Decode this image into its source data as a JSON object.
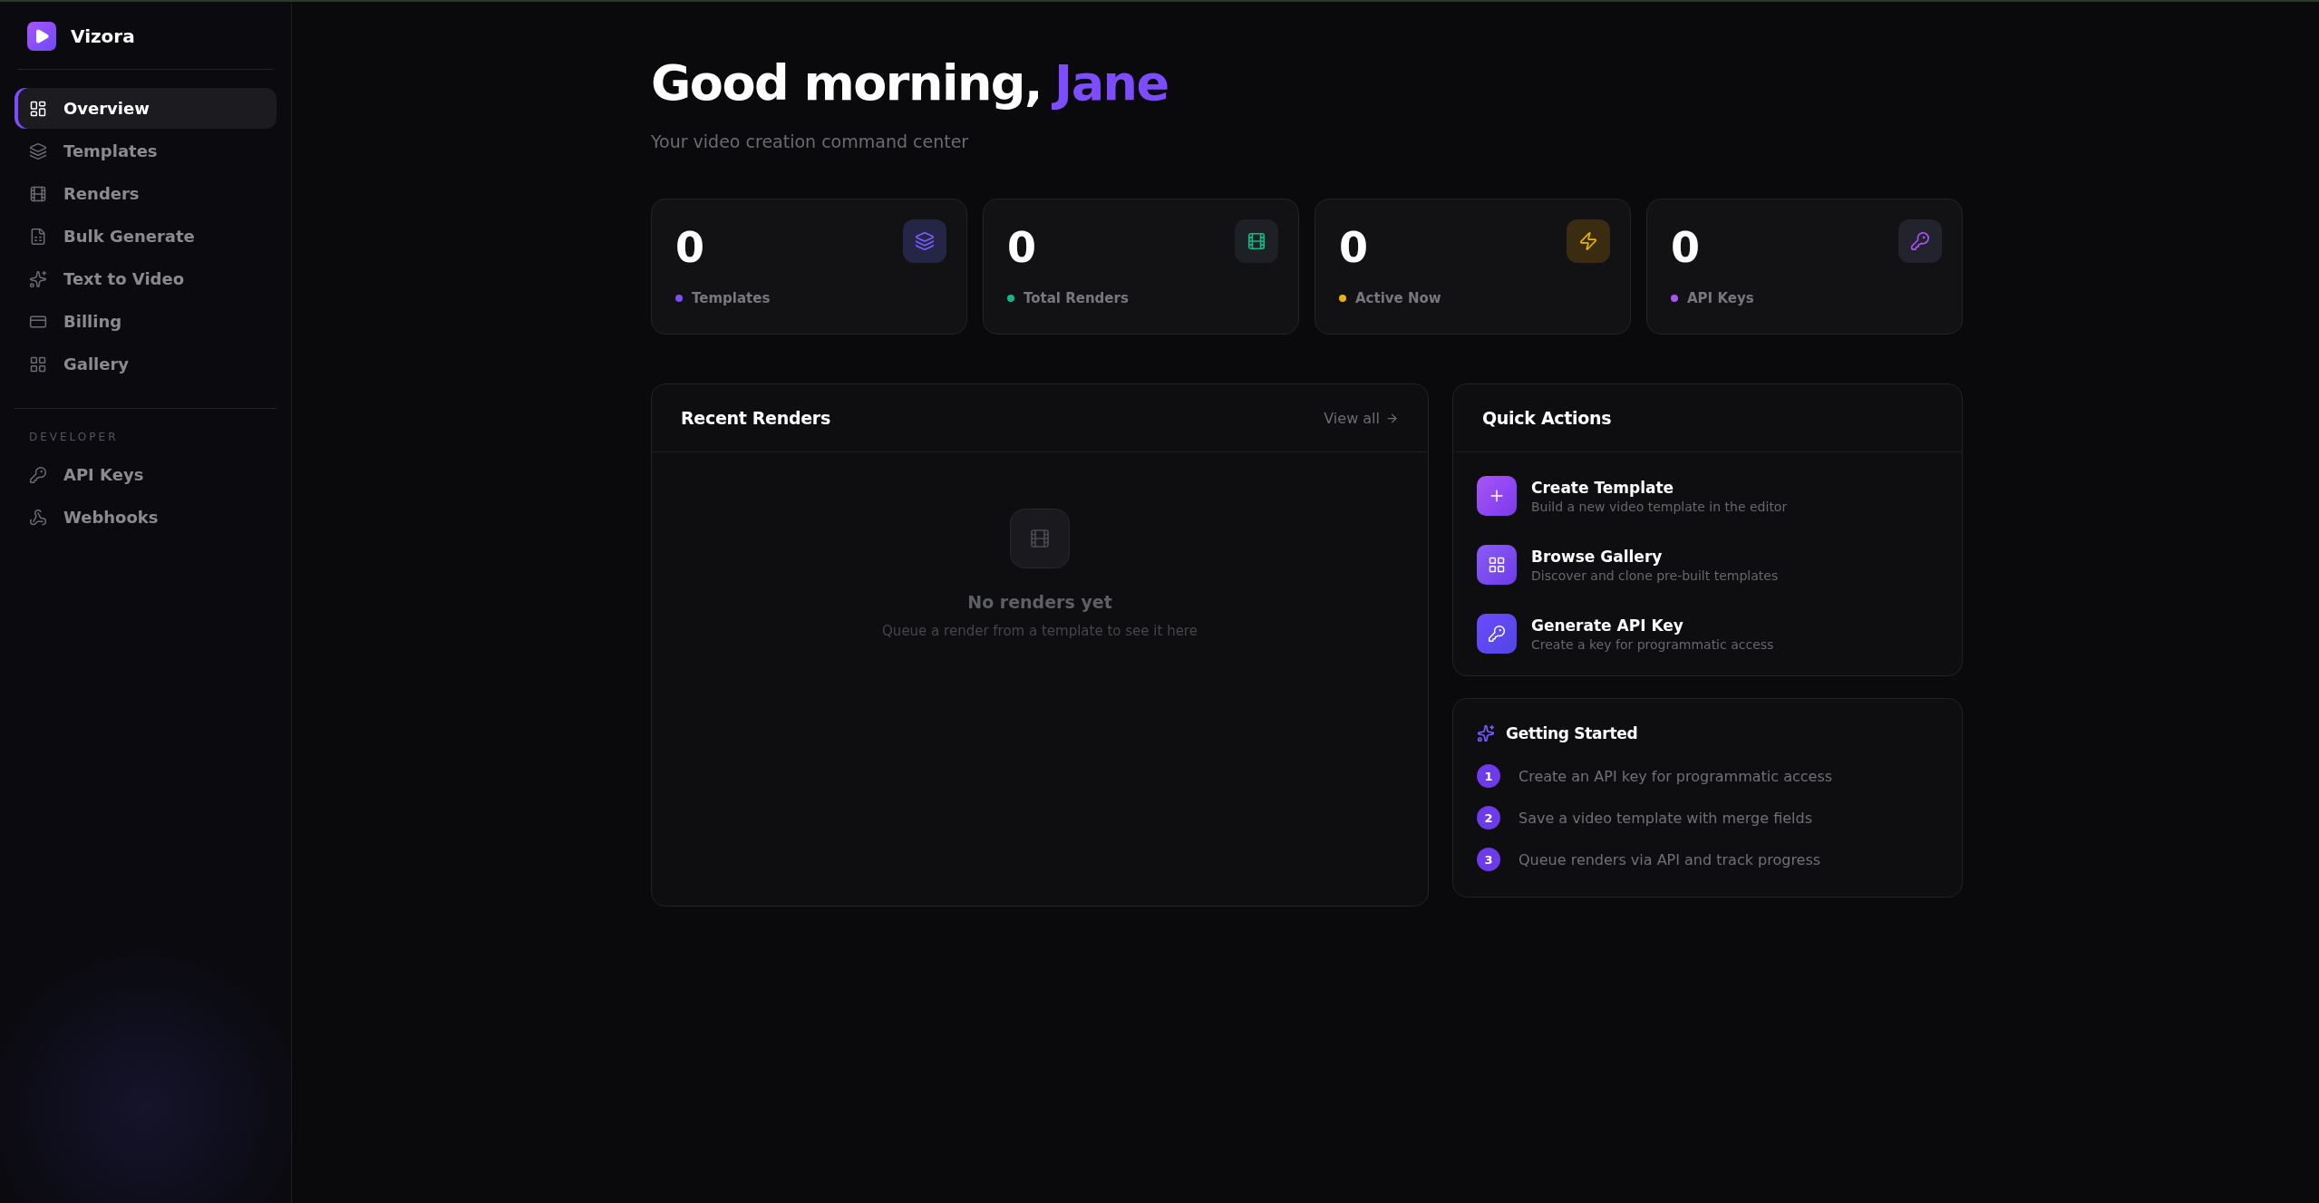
{
  "brand": {
    "name": "Vizora"
  },
  "nav": [
    {
      "label": "Overview",
      "kind": "overview",
      "selected": true
    },
    {
      "label": "Templates",
      "kind": "layers",
      "selected": false
    },
    {
      "label": "Renders",
      "kind": "film",
      "selected": false
    },
    {
      "label": "Bulk Generate",
      "kind": "file",
      "selected": false
    },
    {
      "label": "Text to Video",
      "kind": "sparkles",
      "selected": false
    },
    {
      "label": "Billing",
      "kind": "card",
      "selected": false
    },
    {
      "label": "Gallery",
      "kind": "grid",
      "selected": false
    }
  ],
  "developer": {
    "heading": "DEVELOPER",
    "items": [
      {
        "label": "API Keys",
        "kind": "key",
        "selected": false
      },
      {
        "label": "Webhooks",
        "kind": "webhook",
        "selected": false
      }
    ]
  },
  "header": {
    "greeting": "Good morning,",
    "name": "Jane",
    "subtitle": "Your video creation command center"
  },
  "stats": [
    {
      "value": "0",
      "label": "Templates",
      "kind": "layers",
      "color": "#7c4dff"
    },
    {
      "value": "0",
      "label": "Total Renders",
      "kind": "film",
      "color": "#10b981"
    },
    {
      "value": "0",
      "label": "Active Now",
      "kind": "zap",
      "color": "#eab308"
    },
    {
      "value": "0",
      "label": "API Keys",
      "kind": "key",
      "color": "#a855f7"
    }
  ],
  "recent_renders": {
    "title": "Recent Renders",
    "link": "View all",
    "empty_title": "No renders yet",
    "empty_text": "Queue a render from a template to see it here"
  },
  "quick_actions": {
    "title": "Quick Actions",
    "items": [
      {
        "title": "Create Template",
        "text": "Build a new video template in the editor",
        "kind": "plus"
      },
      {
        "title": "Browse Gallery",
        "text": "Discover and clone pre-built templates",
        "kind": "grid"
      },
      {
        "title": "Generate API Key",
        "text": "Create a key for programmatic access",
        "kind": "key"
      }
    ]
  },
  "getting_started": {
    "title": "Getting Started",
    "steps": [
      {
        "number": "1",
        "text": "Create an API key for programmatic access"
      },
      {
        "number": "2",
        "text": "Save a video template with merge fields"
      },
      {
        "number": "3",
        "text": "Queue renders via API and track progress"
      }
    ]
  }
}
